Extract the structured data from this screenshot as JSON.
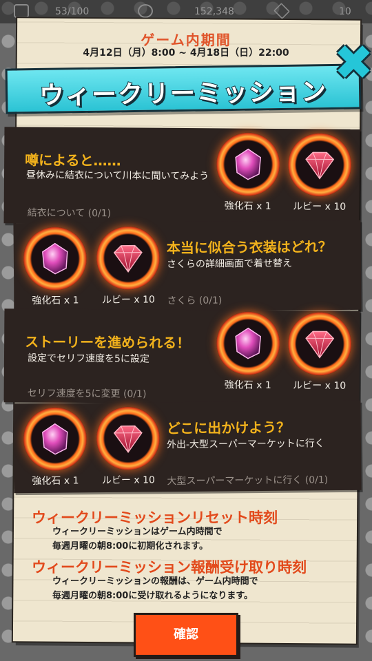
{
  "status": {
    "stamina": "53/100",
    "coins": "152,348",
    "gems": "10"
  },
  "period": {
    "label": "ゲーム内期間",
    "range": "4月12日（月）8:00 ~ 4月18日（日）22:00"
  },
  "title": "ウィークリーミッション",
  "missions": [
    {
      "title": "噂によると……",
      "desc": "昼休みに結衣について川本に聞いてみよう",
      "progress": "結衣について (0/1)",
      "rewards": [
        {
          "label": "強化石 x 1",
          "icon": "enhance-stone-icon"
        },
        {
          "label": "ルビー x 10",
          "icon": "ruby-icon"
        }
      ]
    },
    {
      "title": "本当に似合う衣装はどれ？",
      "desc": "さくらの詳細画面で着せ替え",
      "progress": "さくら (0/1)",
      "rewards": [
        {
          "label": "強化石 x 1",
          "icon": "enhance-stone-icon"
        },
        {
          "label": "ルビー x 10",
          "icon": "ruby-icon"
        }
      ]
    },
    {
      "title": "ストーリーを進められる！",
      "desc": "設定でセリフ速度を5に設定",
      "progress": "セリフ速度を5に変更 (0/1)",
      "rewards": [
        {
          "label": "強化石 x 1",
          "icon": "enhance-stone-icon"
        },
        {
          "label": "ルビー x 10",
          "icon": "ruby-icon"
        }
      ]
    },
    {
      "title": "どこに出かけよう？",
      "desc": "外出-大型スーパーマーケットに行く",
      "progress": "大型スーパーマーケットに行く (0/1)",
      "rewards": [
        {
          "label": "強化石 x 1",
          "icon": "enhance-stone-icon"
        },
        {
          "label": "ルビー x 10",
          "icon": "ruby-icon"
        }
      ]
    }
  ],
  "reset_info": {
    "title": "ウィークリーミッションリセット時刻",
    "line1": "ウィークリーミッションはゲーム内時間で",
    "line2": "毎週月曜の朝8:00に初期化されます。"
  },
  "reward_info": {
    "title": "ウィークリーミッション報酬受け取り時刻",
    "line1": "ウィークリーミッションの報酬は、ゲーム内時間で",
    "line2": "毎週月曜の朝8:00に受け取れるようになります。"
  },
  "confirm_label": "確認",
  "colors": {
    "accent_orange": "#ff5016",
    "title_cyan": "#2bc3d4",
    "mission_title": "#f2b21c",
    "info_title": "#e24a1c"
  }
}
